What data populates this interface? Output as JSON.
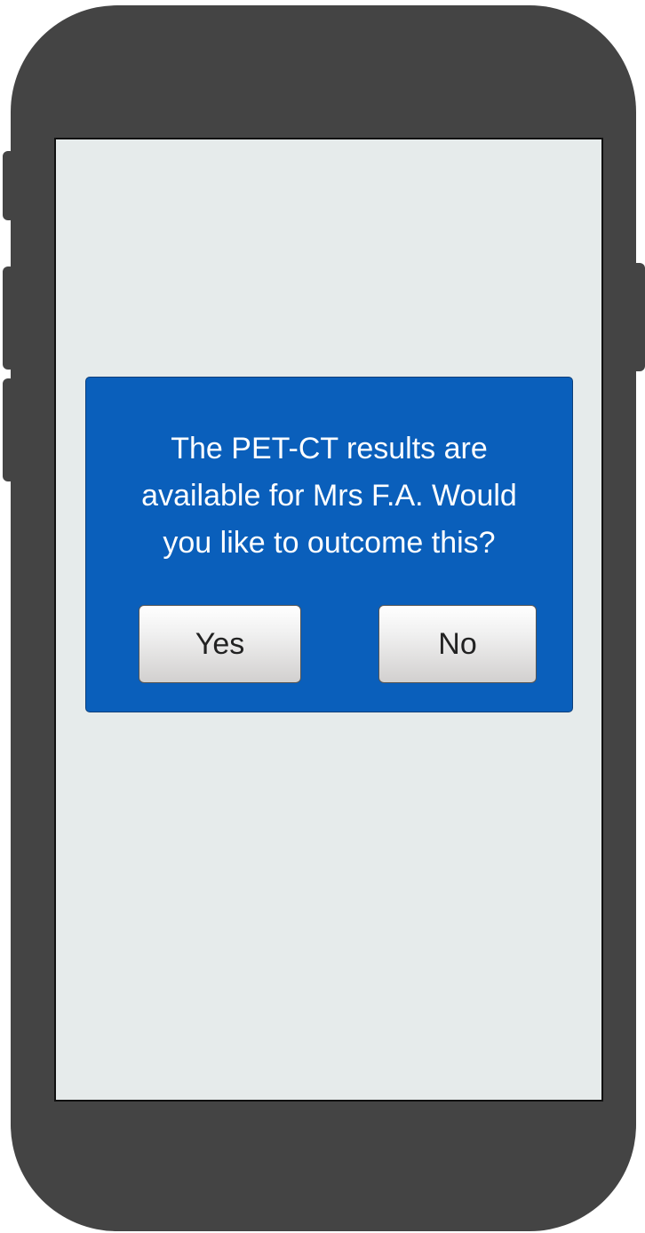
{
  "dialog": {
    "message": "The PET-CT results are\navailable for Mrs F.A. Would\nyou like to outcome this?",
    "yes_label": "Yes",
    "no_label": "No"
  },
  "colors": {
    "phone_body": "#444444",
    "screen_background": "#e6ebeb",
    "dialog_background": "#0a5fbb",
    "dialog_text": "#ffffff",
    "button_text": "#222222"
  }
}
